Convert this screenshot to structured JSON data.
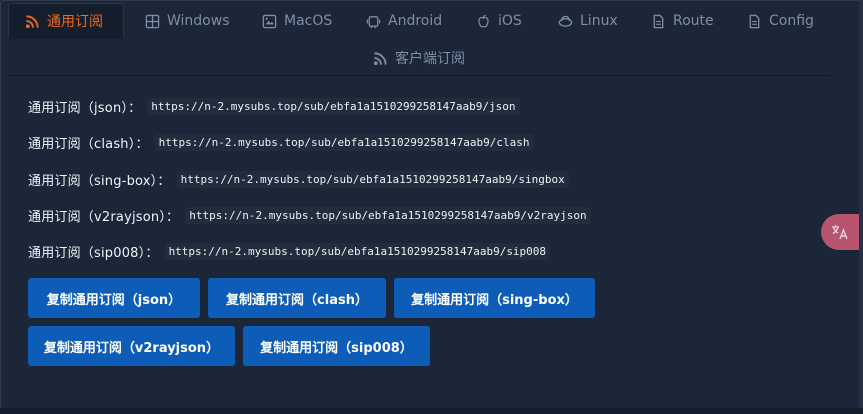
{
  "tabs": [
    {
      "label": "通用订阅",
      "icon": "rss-icon",
      "active": true
    },
    {
      "label": "Windows",
      "icon": "windows-icon"
    },
    {
      "label": "MacOS",
      "icon": "macos-icon"
    },
    {
      "label": "Android",
      "icon": "android-icon"
    },
    {
      "label": "iOS",
      "icon": "apple-icon"
    },
    {
      "label": "Linux",
      "icon": "linux-icon"
    },
    {
      "label": "Route",
      "icon": "document-icon"
    },
    {
      "label": "Config",
      "icon": "document-icon"
    },
    {
      "label": "客户端订阅",
      "icon": "rss-icon"
    }
  ],
  "links": [
    {
      "label": "通用订阅（json）：",
      "url": "https://n-2.mysubs.top/sub/ebfa1a1510299258147aab9/json"
    },
    {
      "label": "通用订阅（clash）：",
      "url": "https://n-2.mysubs.top/sub/ebfa1a1510299258147aab9/clash"
    },
    {
      "label": "通用订阅（sing-box）：",
      "url": "https://n-2.mysubs.top/sub/ebfa1a1510299258147aab9/singbox"
    },
    {
      "label": "通用订阅（v2rayjson）：",
      "url": "https://n-2.mysubs.top/sub/ebfa1a1510299258147aab9/v2rayjson"
    },
    {
      "label": "通用订阅（sip008）：",
      "url": "https://n-2.mysubs.top/sub/ebfa1a1510299258147aab9/sip008"
    }
  ],
  "buttons": [
    "复制通用订阅（json）",
    "复制通用订阅（clash）",
    "复制通用订阅（sing-box）",
    "复制通用订阅（v2rayjson）",
    "复制通用订阅（sip008）"
  ],
  "colors": {
    "background": "#1b2638",
    "accent": "#f26a21",
    "button": "#0d5db8",
    "tab_inactive": "#7f8ea4",
    "translate_badge": "#b7556e"
  },
  "translate_badge": {
    "icon": "translate-icon"
  }
}
